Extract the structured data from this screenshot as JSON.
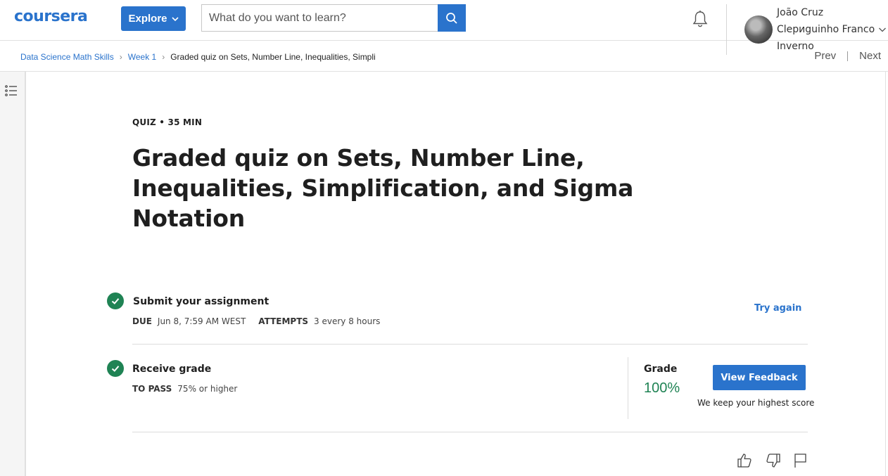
{
  "header": {
    "logo": "coursera",
    "explore_label": "Explore",
    "search_placeholder": "What do you want to learn?",
    "user": {
      "name_line1": "João Cruz",
      "name_line2": "Clериguinho Franco",
      "name_line3": "Inverno"
    },
    "icons": {
      "search": "search-icon",
      "bell": "bell-icon",
      "chevron": "chevron-down-icon"
    }
  },
  "breadcrumb": {
    "items": [
      "Data Science Math Skills",
      "Week 1"
    ],
    "current": "Graded quiz on Sets, Number Line, Inequalities, Simpli"
  },
  "nav": {
    "prev": "Prev",
    "next": "Next"
  },
  "quiz": {
    "meta": "QUIZ • 35 MIN",
    "title": "Graded quiz on Sets, Number Line, Inequalities, Simplification, and Sigma Notation"
  },
  "submit": {
    "title": "Submit your assignment",
    "due_label": "DUE",
    "due_value": "Jun 8, 7:59 AM WEST",
    "attempts_label": "ATTEMPTS",
    "attempts_value": "3 every 8 hours",
    "try_again": "Try again"
  },
  "grade": {
    "title": "Receive grade",
    "to_pass_label": "TO PASS",
    "to_pass_value": "75% or higher",
    "grade_label": "Grade",
    "grade_value": "100%",
    "view_feedback": "View Feedback",
    "keep_note": "We keep your highest score"
  },
  "colors": {
    "brand_blue": "#2a73cc",
    "success_green": "#1f8354"
  }
}
